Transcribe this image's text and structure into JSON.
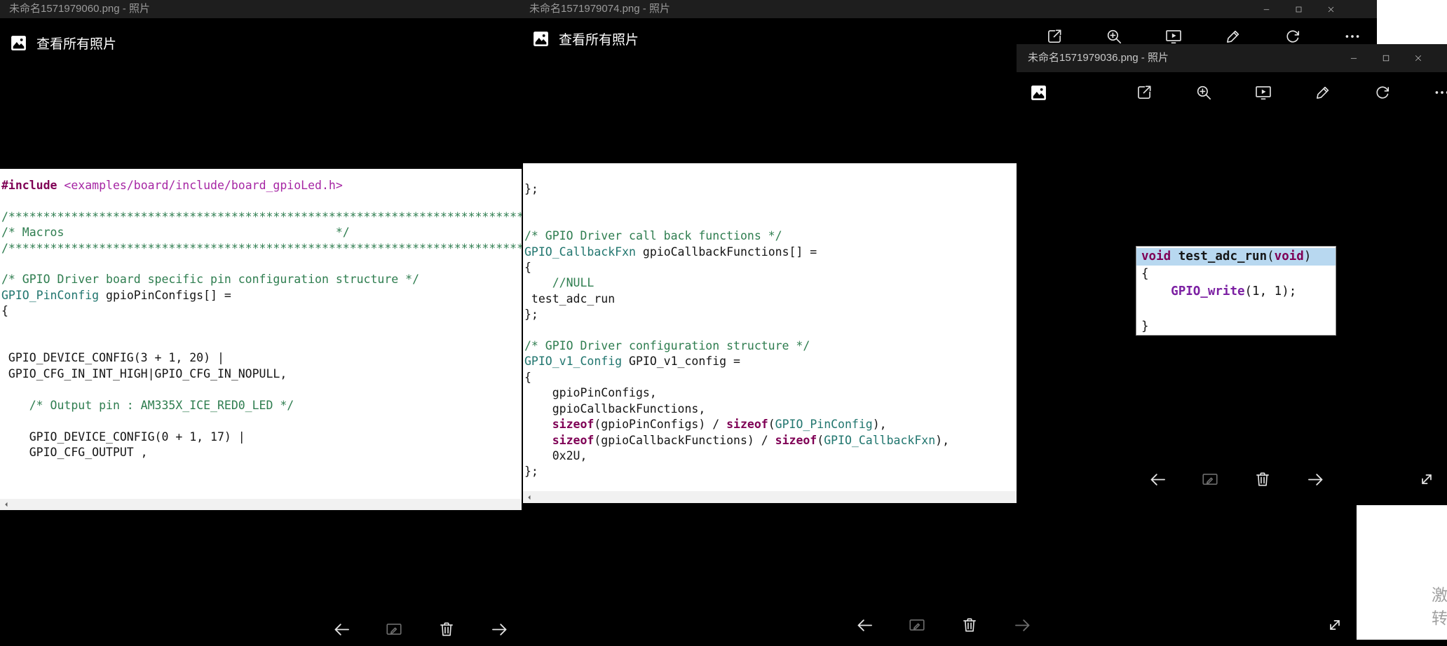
{
  "colors": {
    "app_bg": "#000000",
    "titlebar_bg": "#1e1e1e",
    "title_text": "#9a9a9a",
    "photo_bg": "#ffffff",
    "icon": "#e4e4e4",
    "icon_dim": "#6e6e6e",
    "selection_highlight": "#b8d8f0",
    "code_default": "#151515",
    "code_comment": "#2e7d4f",
    "code_keyword": "#7f0055",
    "code_type": "#20756e",
    "code_include": "#a626a4",
    "code_function": "#7b1fa2",
    "scrollbar_track": "#f1f1f1",
    "watermark_text": "#9f9f9f"
  },
  "icons_legend": {
    "photos-icon": "white picture tile with mountain",
    "share-icon": "box with outgoing arrow",
    "zoom-in-icon": "magnifier with plus",
    "slideshow-icon": "screen with play triangle",
    "edit-icon": "pencil",
    "rotate-icon": "circular arrow",
    "see-more-icon": "ellipsis dots",
    "back-icon": "long left arrow",
    "annotate-icon": "frame with pen",
    "delete-icon": "trash can",
    "forward-icon": "long right arrow",
    "fullscreen-icon": "diagonal expand arrows",
    "minimize-icon": "horizontal line",
    "maximize-icon": "hollow square",
    "close-icon": "cross",
    "scroll-left-icon": "left triangle"
  },
  "windows": {
    "left": {
      "title": "未命名1571979060.png - 照片",
      "view_all": "查看所有照片",
      "nav": [
        "back",
        "annotate",
        "delete",
        "forward"
      ],
      "code": [
        [
          [
            "kw",
            "#include"
          ],
          [
            "d",
            " "
          ],
          [
            "inc",
            "<examples/board/include/board_gpioLed.h>"
          ]
        ],
        [],
        [
          [
            "com",
            "/**************************************************************************/"
          ]
        ],
        [
          [
            "com",
            "/* Macros                                       */"
          ]
        ],
        [
          [
            "com",
            "/**************************************************************************/"
          ]
        ],
        [],
        [
          [
            "com",
            "/* GPIO Driver board specific pin configuration structure */"
          ]
        ],
        [
          [
            "typ",
            "GPIO_PinConfig"
          ],
          [
            "d",
            " gpioPinConfigs[] ="
          ]
        ],
        [
          [
            "d",
            "{"
          ]
        ],
        [],
        [],
        [
          [
            "d",
            " GPIO_DEVICE_CONFIG(3 + 1, 20) |"
          ]
        ],
        [
          [
            "d",
            " GPIO_CFG_IN_INT_HIGH|GPIO_CFG_IN_NOPULL,"
          ]
        ],
        [],
        [
          [
            "com",
            "    /* Output pin : AM335X_ICE_RED0_LED */"
          ]
        ],
        [],
        [
          [
            "d",
            "    GPIO_DEVICE_CONFIG(0 + 1, 17) |"
          ]
        ],
        [
          [
            "d",
            "    GPIO_CFG_OUTPUT ,"
          ]
        ]
      ]
    },
    "middle": {
      "title": "未命名1571979074.png - 照片",
      "view_all": "查看所有照片",
      "window_controls": [
        "minimize",
        "maximize",
        "close"
      ],
      "toolbar": [
        "share",
        "zoom-in",
        "slideshow",
        "edit",
        "rotate",
        "see-more"
      ],
      "nav": [
        "back",
        "annotate",
        "delete",
        "forward",
        "fullscreen"
      ],
      "code": [
        [
          [
            "d",
            "};"
          ]
        ],
        [],
        [],
        [
          [
            "com",
            "/* GPIO Driver call back functions */"
          ]
        ],
        [
          [
            "typ",
            "GPIO_CallbackFxn"
          ],
          [
            "d",
            " gpioCallbackFunctions[] ="
          ]
        ],
        [
          [
            "d",
            "{"
          ]
        ],
        [
          [
            "com",
            "    //NULL"
          ]
        ],
        [
          [
            "d",
            " test_adc_run"
          ]
        ],
        [
          [
            "d",
            "};"
          ]
        ],
        [],
        [
          [
            "com",
            "/* GPIO Driver configuration structure */"
          ]
        ],
        [
          [
            "typ",
            "GPIO_v1_Config"
          ],
          [
            "d",
            " GPIO_v1_config ="
          ]
        ],
        [
          [
            "d",
            "{"
          ]
        ],
        [
          [
            "d",
            "    gpioPinConfigs,"
          ]
        ],
        [
          [
            "d",
            "    gpioCallbackFunctions,"
          ]
        ],
        [
          [
            "d",
            "    "
          ],
          [
            "kw",
            "sizeof"
          ],
          [
            "d",
            "(gpioPinConfigs) / "
          ],
          [
            "kw",
            "sizeof"
          ],
          [
            "d",
            "("
          ],
          [
            "typ",
            "GPIO_PinConfig"
          ],
          [
            "d",
            "),"
          ]
        ],
        [
          [
            "d",
            "    "
          ],
          [
            "kw",
            "sizeof"
          ],
          [
            "d",
            "(gpioCallbackFunctions) / "
          ],
          [
            "kw",
            "sizeof"
          ],
          [
            "d",
            "("
          ],
          [
            "typ",
            "GPIO_CallbackFxn"
          ],
          [
            "d",
            "),"
          ]
        ],
        [
          [
            "d",
            "    0x2U,"
          ]
        ],
        [
          [
            "d",
            "};"
          ]
        ]
      ]
    },
    "right": {
      "title": "未命名1571979036.png - 照片",
      "window_controls": [
        "minimize",
        "maximize",
        "close"
      ],
      "toolbar": [
        "share",
        "zoom-in",
        "slideshow",
        "edit",
        "rotate",
        "see-more"
      ],
      "nav": [
        "back",
        "annotate",
        "delete",
        "forward",
        "fullscreen"
      ],
      "code": [
        {
          "hl": true,
          "seg": [
            [
              "kw",
              "void"
            ],
            [
              "b",
              " test_adc_run"
            ],
            [
              "d",
              "("
            ],
            [
              "kw",
              "void"
            ],
            [
              "d",
              ")"
            ]
          ]
        },
        [
          [
            "d",
            "{"
          ]
        ],
        [
          [
            "d",
            "    "
          ],
          [
            "fn",
            "GPIO_write"
          ],
          [
            "d",
            "(1, 1);"
          ]
        ],
        [],
        [
          [
            "d",
            "}"
          ]
        ]
      ]
    }
  },
  "watermark": {
    "line1": "激",
    "line2": "转"
  }
}
